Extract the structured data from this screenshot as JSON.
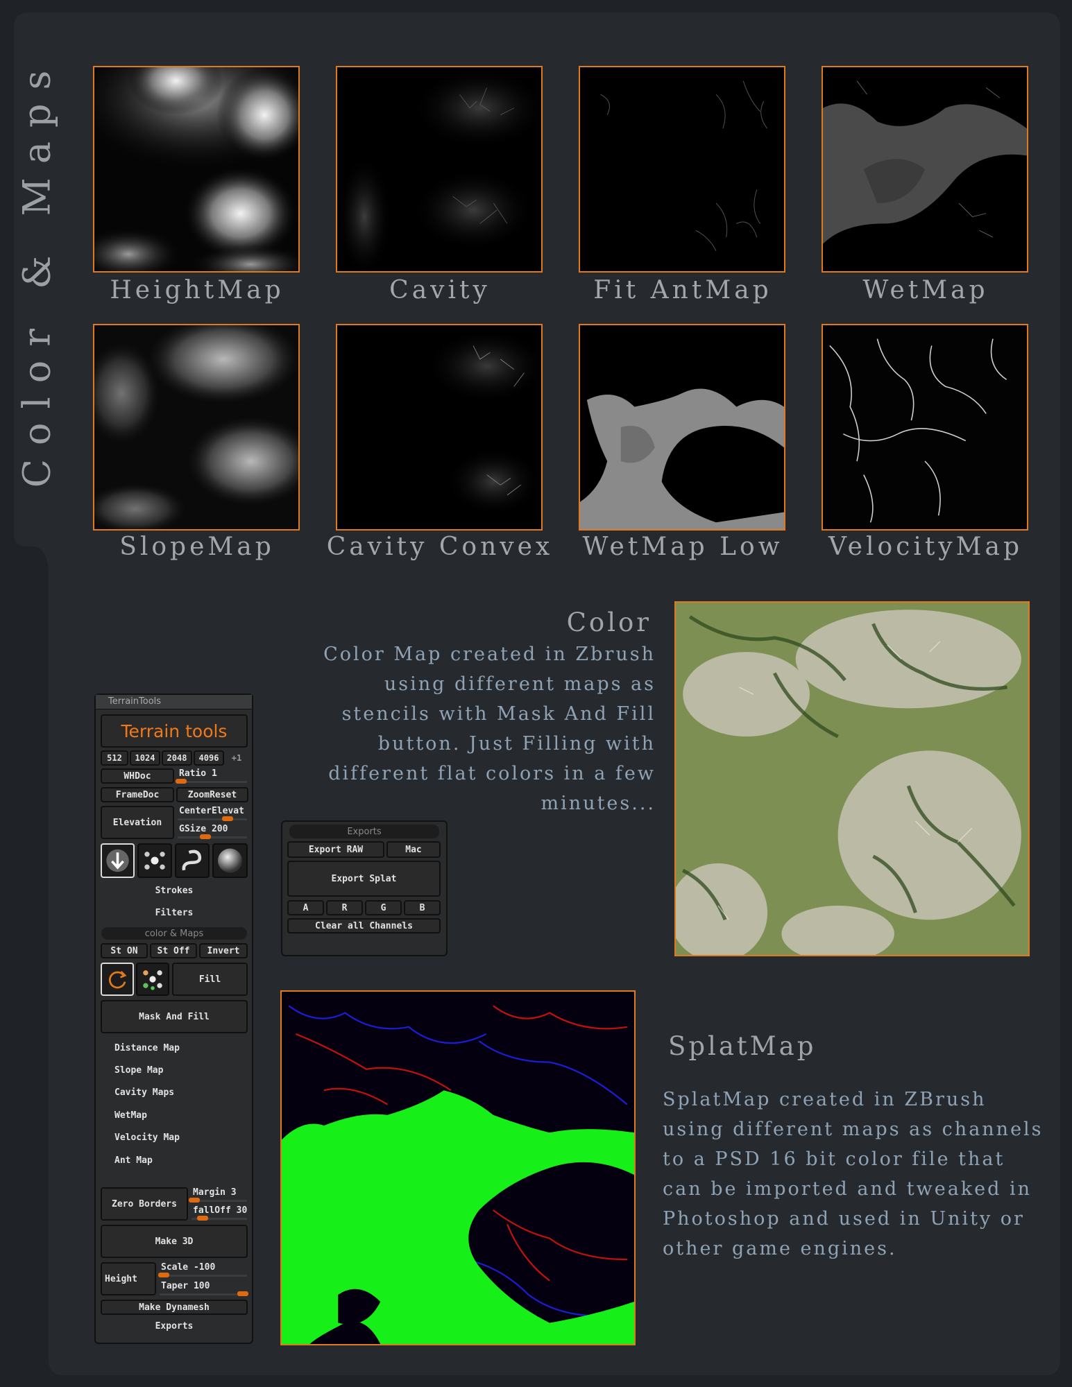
{
  "section_title": "Color & Maps",
  "maps": [
    {
      "label": "HeightMap"
    },
    {
      "label": "Cavity"
    },
    {
      "label": "Fit AntMap"
    },
    {
      "label": "WetMap"
    },
    {
      "label": "SlopeMap"
    },
    {
      "label": "Cavity Convex"
    },
    {
      "label": "WetMap Low"
    },
    {
      "label": "VelocityMap"
    }
  ],
  "color": {
    "title": "Color",
    "description": "Color Map created in Zbrush using different maps as stencils with Mask And Fill button. Just Filling with different flat colors in a few minutes..."
  },
  "splat": {
    "title": "SplatMap",
    "description": "SplatMap created in ZBrush using different maps as channels to a PSD 16 bit color file that can be imported and tweaked in Photoshop and used in Unity or other game engines."
  },
  "terrain_panel": {
    "header": "TerrainTools",
    "title_button": "Terrain tools",
    "sizes": [
      "512",
      "1024",
      "2048",
      "4096",
      "+1"
    ],
    "whdoc": "WHDoc",
    "ratio": "Ratio 1",
    "ratio_level": 0.05,
    "framedoc": "FrameDoc",
    "zoomreset": "ZoomReset",
    "elevation": "Elevation",
    "centerelevat": "CenterElevat",
    "centerelevat_level": 0.72,
    "gsize": "GSize 200",
    "gsize_level": 0.4,
    "strokes": "Strokes",
    "filters": "Filters",
    "color_maps_header": "color & Maps",
    "st_on": "St ON",
    "st_off": "St Off",
    "invert": "Invert",
    "fill": "Fill",
    "mask_and_fill": "Mask And Fill",
    "menu_items": [
      "Distance Map",
      "Slope Map",
      "Cavity Maps",
      "WetMap",
      "Velocity Map",
      "Ant Map"
    ],
    "zero_borders": "Zero Borders",
    "margin": "Margin 3",
    "margin_level": 0.05,
    "falloff": "fallOff 30",
    "falloff_level": 0.2,
    "make_3d": "Make 3D",
    "height": "Height",
    "scale": "Scale -100",
    "scale_level": 0.05,
    "taper": "Taper 100",
    "taper_level": 0.95,
    "make_dynamesh": "Make Dynamesh",
    "exports": "Exports"
  },
  "exports_panel": {
    "header": "Exports",
    "export_raw": "Export RAW",
    "mac": "Mac",
    "export_splat": "Export Splat",
    "channels": [
      "A",
      "R",
      "G",
      "B"
    ],
    "clear_all": "Clear all Channels"
  },
  "colors": {
    "background": "#1f2226",
    "frame": "#262a2f",
    "accent_border": "#e07a1e",
    "label": "#a3a7ab",
    "description": "#8fa3b5",
    "terrain_title": "#f07a1a"
  }
}
